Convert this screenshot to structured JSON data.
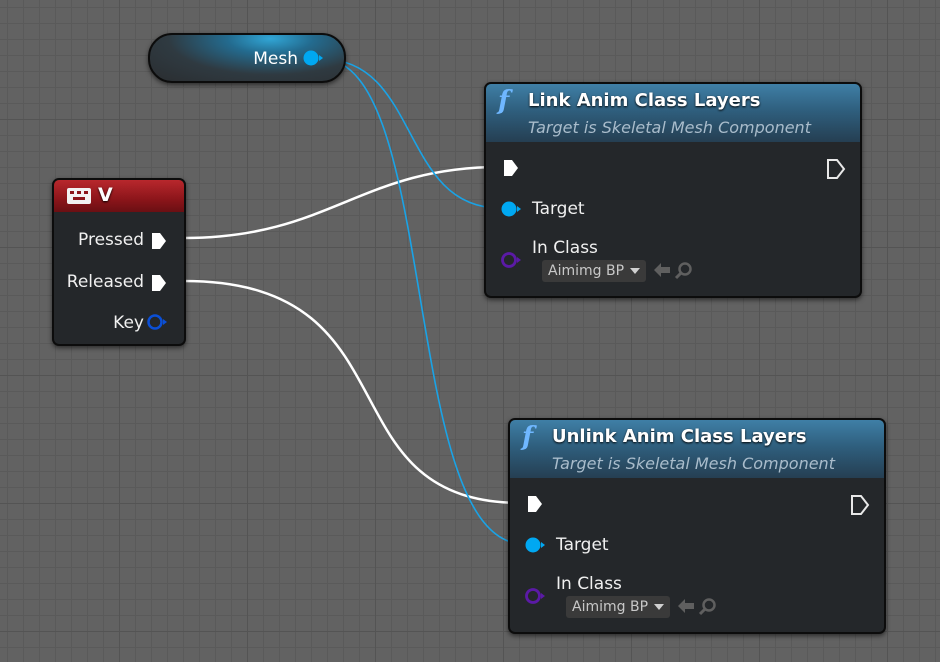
{
  "mesh_node": {
    "label": "Mesh"
  },
  "key_node": {
    "title": "V",
    "pins": {
      "pressed": "Pressed",
      "released": "Released",
      "key": "Key"
    }
  },
  "link_node": {
    "title": "Link Anim Class Layers",
    "subtitle": "Target is Skeletal Mesh Component",
    "target_label": "Target",
    "in_class_label": "In Class",
    "in_class_value": "Aimimg BP"
  },
  "unlink_node": {
    "title": "Unlink Anim Class Layers",
    "subtitle": "Target is Skeletal Mesh Component",
    "target_label": "Target",
    "in_class_label": "In Class",
    "in_class_value": "Aimimg BP"
  },
  "icons": {
    "function": "f",
    "keyboard": "keyboard-icon",
    "use_selected": "arrow-left-icon",
    "browse": "magnifier-icon"
  },
  "colors": {
    "exec_wire": "#ffffff",
    "object_wire": "#1aa3e6",
    "object_pin": "#00a8f2",
    "class_pin": "#5b1aa6",
    "function_header": "#2f5f7e",
    "event_header": "#8c151a"
  }
}
